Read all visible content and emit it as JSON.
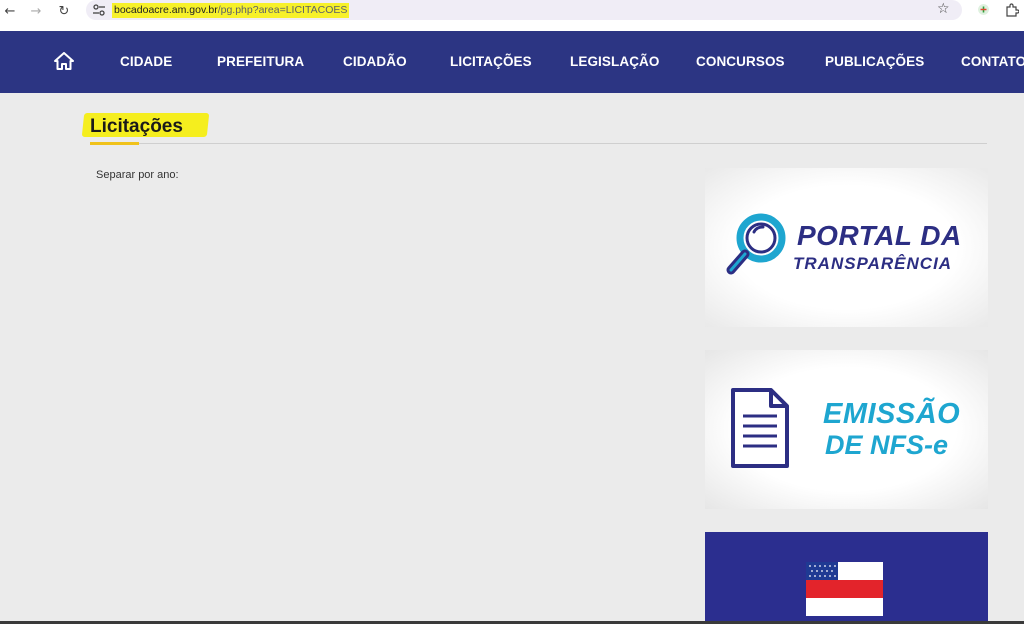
{
  "browser": {
    "url_domain": "bocadoacre.am.gov.br",
    "url_path": "/pg.php?area=LICITACOES"
  },
  "navbar": {
    "items": [
      "CIDADE",
      "PREFEITURA",
      "CIDADÃO",
      "LICITAÇÕES",
      "LEGISLAÇÃO",
      "CONCURSOS",
      "PUBLICAÇÕES",
      "CONTATO"
    ],
    "home_icon": "home-icon",
    "background": "#2c3583"
  },
  "main": {
    "title": "Licitações",
    "filter_label": "Separar por ano:"
  },
  "sidebar": {
    "portal_banner": {
      "line1": "PORTAL DA",
      "line2": "TRANSPARÊNCIA"
    },
    "nfse_banner": {
      "line1": "EMISSÃO",
      "line2": "DE NFS-e"
    },
    "flag_banner": {
      "icon": "amazonas-flag-icon"
    }
  },
  "colors": {
    "accent_yellow": "#f5ee1e",
    "portal_blue": "#2c2e83",
    "nfse_cyan": "#1ea6d0"
  }
}
